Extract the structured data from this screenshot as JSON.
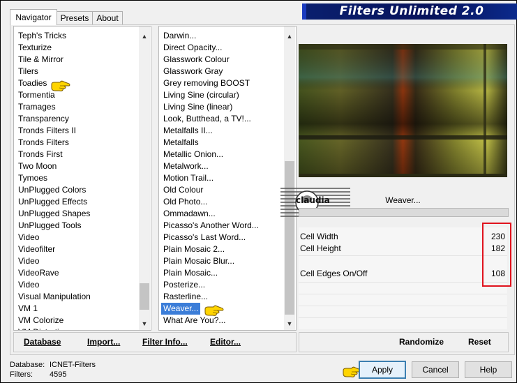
{
  "tabs": [
    {
      "label": "Navigator",
      "active": true
    },
    {
      "label": "Presets",
      "active": false
    },
    {
      "label": "About",
      "active": false
    }
  ],
  "title": "Filters Unlimited 2.0",
  "categories": {
    "items": [
      "Teph's Tricks",
      "Texturize",
      "Tile & Mirror",
      "Tilers",
      "Toadies",
      "Tormentia",
      "Tramages",
      "Transparency",
      "Tronds Filters II",
      "Tronds Filters",
      "Tronds First",
      "Two Moon",
      "Tymoes",
      "UnPlugged Colors",
      "UnPlugged Effects",
      "UnPlugged Shapes",
      "UnPlugged Tools",
      "Video",
      "Videofilter",
      "Video",
      "VideoRave",
      "Video",
      "Visual Manipulation",
      "VM 1",
      "VM Colorize",
      "VM Distortion"
    ],
    "selected": "Toadies"
  },
  "filters": {
    "items": [
      "Darwin...",
      "Direct Opacity...",
      "Glasswork Colour",
      "Glasswork Gray",
      "Grey removing BOOST",
      "Living Sine (circular)",
      "Living Sine (linear)",
      "Look, Butthead, a TV!...",
      "Metalfalls II...",
      "Metalfalls",
      "Metallic Onion...",
      "Metalwork...",
      "Motion Trail...",
      "Old Colour",
      "Old Photo...",
      "Ommadawn...",
      "Picasso's Another Word...",
      "Picasso's Last Word...",
      "Plain Mosaic 2...",
      "Plain Mosaic Blur...",
      "Plain Mosaic...",
      "Posterize...",
      "Rasterline...",
      "Weaver...",
      "What Are You?..."
    ],
    "selected": "Weaver..."
  },
  "left_buttons": {
    "database": "Database",
    "import": "Import...",
    "filter_info": "Filter Info...",
    "editor": "Editor..."
  },
  "right_buttons": {
    "randomize": "Randomize",
    "reset": "Reset"
  },
  "filter_name": "Weaver...",
  "parameters": [
    {
      "label": "Cell Width",
      "value": "230"
    },
    {
      "label": "Cell Height",
      "value": "182"
    },
    {
      "label": "Cell Edges On/Off",
      "value": "108"
    }
  ],
  "info": {
    "database_label": "Database:",
    "database_value": "ICNET-Filters",
    "filters_label": "Filters:",
    "filters_value": "4595"
  },
  "actions": {
    "apply": "Apply",
    "cancel": "Cancel",
    "help": "Help"
  },
  "logo_text": "claudia",
  "colors": {
    "title_bg": "#07125a",
    "selection": "#3b7dd8",
    "highlight_box": "#e0131d"
  }
}
